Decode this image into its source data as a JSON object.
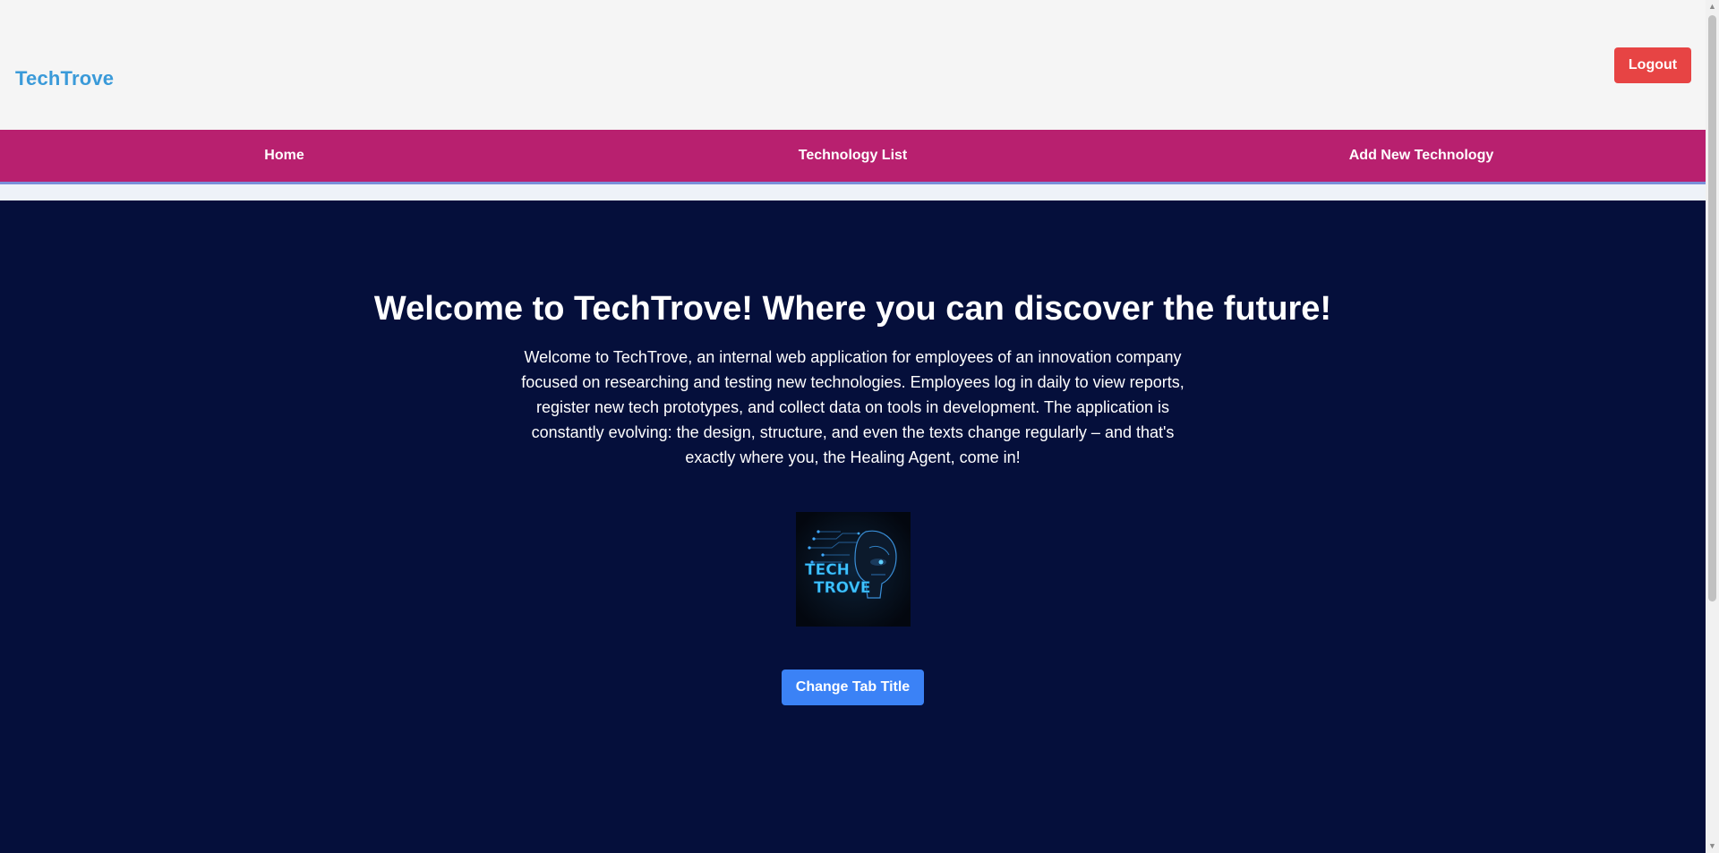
{
  "header": {
    "brand": "TechTrove",
    "logout_label": "Logout"
  },
  "nav": {
    "items": [
      {
        "label": "Home"
      },
      {
        "label": "Technology List"
      },
      {
        "label": "Add New Technology"
      }
    ]
  },
  "main": {
    "title": "Welcome to TechTrove! Where you can discover the future!",
    "description": "Welcome to TechTrove, an internal web application for employees of an innovation company focused on researching and testing new technologies. Employees log in daily to view reports, register new tech prototypes, and collect data on tools in development. The application is constantly evolving: the design, structure, and even the texts change regularly – and that's exactly where you, the Healing Agent, come in!",
    "logo": {
      "line1": "TECH",
      "line2": "TROVE"
    },
    "cta_label": "Change Tab Title"
  },
  "colors": {
    "brand": "#3a9ad9",
    "logout": "#e74444",
    "nav_bg": "#b8206f",
    "hero_bg": "#050f3b",
    "cta": "#3b82f6"
  },
  "icons": {
    "scroll_up": "scroll-up-arrow-icon",
    "scroll_down": "scroll-down-arrow-icon"
  }
}
